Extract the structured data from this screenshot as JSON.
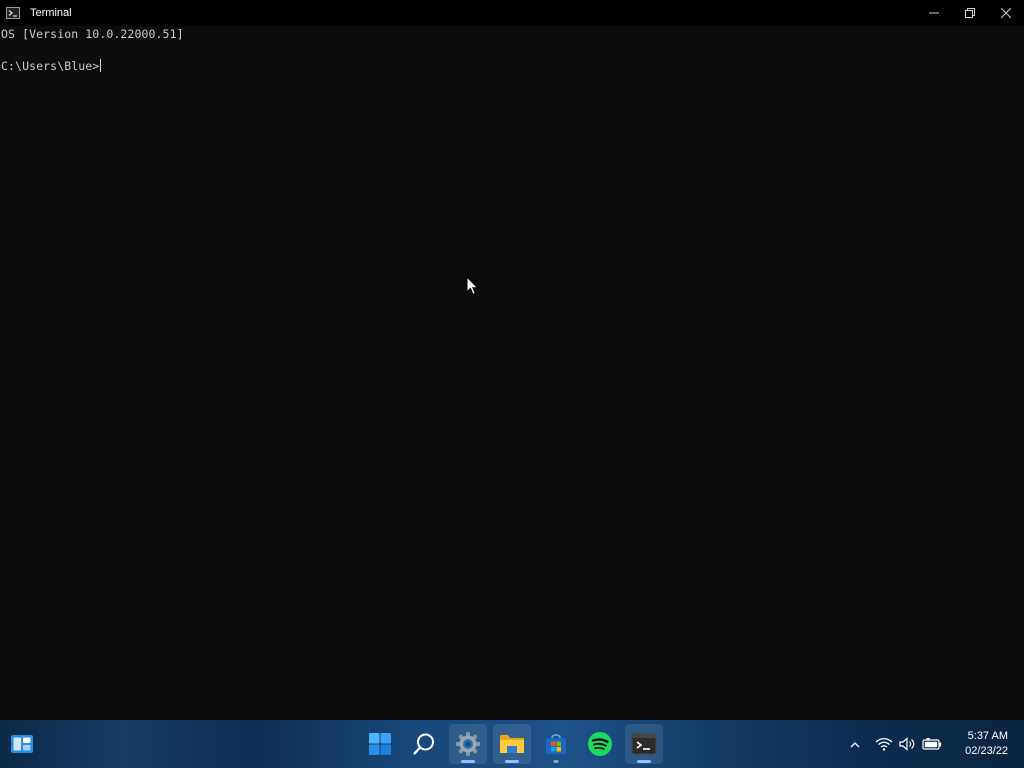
{
  "window": {
    "title": "Terminal",
    "icon": "terminal-icon"
  },
  "console": {
    "lines": [
      "OS [Version 10.0.22000.51]",
      "",
      "C:\\Users\\Blue>"
    ],
    "background": "#0c0c0c",
    "text_color": "#cccccc"
  },
  "taskbar": {
    "widgets_icon": "widgets-icon",
    "pinned": [
      {
        "name": "Start",
        "icon": "windows-start-icon"
      },
      {
        "name": "Search",
        "icon": "search-icon"
      },
      {
        "name": "Settings",
        "icon": "settings-gear-icon"
      },
      {
        "name": "File Explorer",
        "icon": "folder-icon"
      },
      {
        "name": "Microsoft Store",
        "icon": "store-icon"
      },
      {
        "name": "Spotify",
        "icon": "spotify-icon"
      },
      {
        "name": "Terminal",
        "icon": "terminal-icon"
      }
    ],
    "tray": [
      "chevron-up-icon",
      "wifi-icon",
      "volume-icon",
      "battery-icon"
    ],
    "clock": {
      "time": "5:37 AM",
      "date": "02/23/22"
    },
    "accent": "#8ec3ff"
  }
}
